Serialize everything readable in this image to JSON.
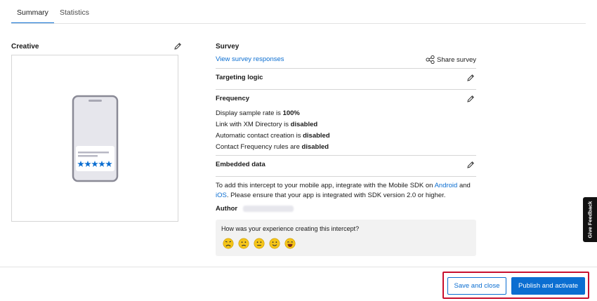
{
  "tabs": [
    {
      "label": "Summary",
      "active": true
    },
    {
      "label": "Statistics",
      "active": false
    }
  ],
  "creative": {
    "title": "Creative",
    "edit_icon": "pencil-icon",
    "phone_icon": "phone-illustration",
    "star_icon": "star-icon"
  },
  "survey": {
    "title": "Survey",
    "view_responses_link": "View survey responses",
    "share_label": "Share survey",
    "share_icon": "share-icon"
  },
  "targeting": {
    "title": "Targeting logic"
  },
  "frequency": {
    "title": "Frequency",
    "lines": [
      {
        "prefix": "Display sample rate is ",
        "value": "100%"
      },
      {
        "prefix": "Link with XM Directory is ",
        "value": "disabled"
      },
      {
        "prefix": "Automatic contact creation is ",
        "value": "disabled"
      },
      {
        "prefix": "Contact Frequency rules are ",
        "value": "disabled"
      }
    ]
  },
  "embedded": {
    "title": "Embedded data"
  },
  "sdk_note": {
    "part1": "To add this intercept to your mobile app, integrate with the Mobile SDK on ",
    "android": "Android",
    "and": " and",
    "ios": "iOS",
    "part2": ". Please ensure that your app is integrated with SDK version 2.0 or higher."
  },
  "author": {
    "label": "Author"
  },
  "feedback": {
    "question": "How was your experience creating this intercept?",
    "emojis": [
      "very-unhappy-face-icon",
      "unhappy-face-icon",
      "neutral-face-icon",
      "happy-face-icon",
      "very-happy-face-icon"
    ]
  },
  "actions": {
    "save_close": "Save and close",
    "publish": "Publish and activate"
  },
  "give_feedback": "Give Feedback",
  "colors": {
    "accent": "#0b6ed1",
    "highlight_border": "#c8102e",
    "star": "#0b6ed1",
    "emoji": "#f5c518"
  }
}
